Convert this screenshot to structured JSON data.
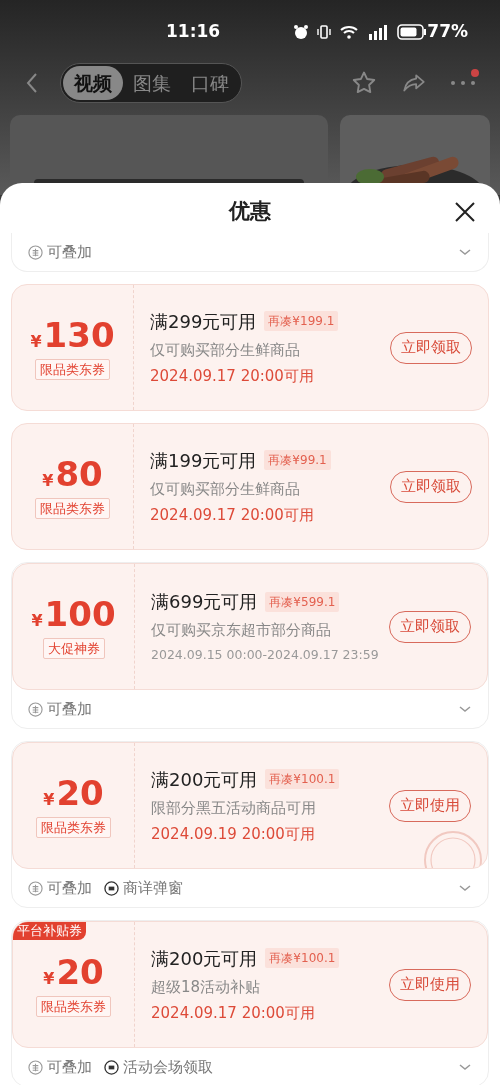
{
  "status_bar": {
    "time": "11:16",
    "battery": "77%"
  },
  "nav": {
    "tabs": [
      {
        "label": "视频",
        "selected": true
      },
      {
        "label": "图集",
        "selected": false
      },
      {
        "label": "口碑",
        "selected": false
      }
    ],
    "more_badge": true
  },
  "sheet": {
    "title": "优惠"
  },
  "top_footer": {
    "tags": [
      {
        "kind": "stack",
        "label": "可叠加"
      }
    ]
  },
  "coupons": [
    {
      "currency": "¥",
      "amount": "130",
      "type": "限品类东券",
      "condition": "满299元可用",
      "gap": "再凑¥199.1",
      "scope": "仅可购买部分生鲜商品",
      "time": "2024.09.17 20:00可用",
      "kind": "start",
      "button": "立即领取",
      "claimed": false
    },
    {
      "currency": "¥",
      "amount": "80",
      "type": "限品类东券",
      "condition": "满199元可用",
      "gap": "再凑¥99.1",
      "scope": "仅可购买部分生鲜商品",
      "time": "2024.09.17 20:00可用",
      "kind": "start",
      "button": "立即领取",
      "claimed": false
    },
    {
      "currency": "¥",
      "amount": "100",
      "type": "大促神券",
      "condition": "满699元可用",
      "gap": "再凑¥599.1",
      "scope": "仅可购买京东超市部分商品",
      "time": "2024.09.15 00:00-2024.09.17 23:59",
      "kind": "range",
      "button": "立即领取",
      "claimed": false,
      "tags": [
        {
          "kind": "stack",
          "label": "可叠加"
        }
      ]
    },
    {
      "currency": "¥",
      "amount": "20",
      "type": "限品类东券",
      "condition": "满200元可用",
      "gap": "再凑¥100.1",
      "scope": "限部分黑五活动商品可用",
      "time": "2024.09.19 20:00可用",
      "kind": "start",
      "button": "立即使用",
      "claimed": true,
      "tags": [
        {
          "kind": "stack",
          "label": "可叠加"
        },
        {
          "kind": "popup",
          "label": "商详弹窗"
        }
      ]
    },
    {
      "currency": "¥",
      "amount": "20",
      "type": "限品类东券",
      "condition": "满200元可用",
      "gap": "再凑¥100.1",
      "scope": "超级18活动补贴",
      "time": "2024.09.17 20:00可用",
      "kind": "start",
      "button": "立即使用",
      "claimed": false,
      "ribbon": "平台补贴券",
      "tags": [
        {
          "kind": "stack",
          "label": "可叠加"
        },
        {
          "kind": "popup",
          "label": "活动会场领取"
        }
      ]
    }
  ]
}
